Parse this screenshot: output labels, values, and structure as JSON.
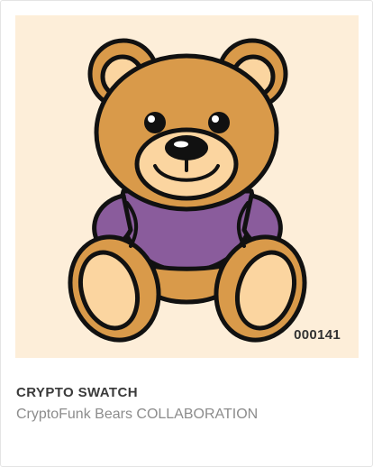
{
  "card": {
    "token_id": "000141",
    "title": "CRYPTO SWATCH",
    "subtitle": "CryptoFunk Bears COLLABORATION"
  },
  "colors": {
    "background": "#fdeed9",
    "fur": "#d99a4a",
    "fur_light": "#fbd5a0",
    "shirt": "#8a5c9c",
    "outline": "#111111"
  }
}
